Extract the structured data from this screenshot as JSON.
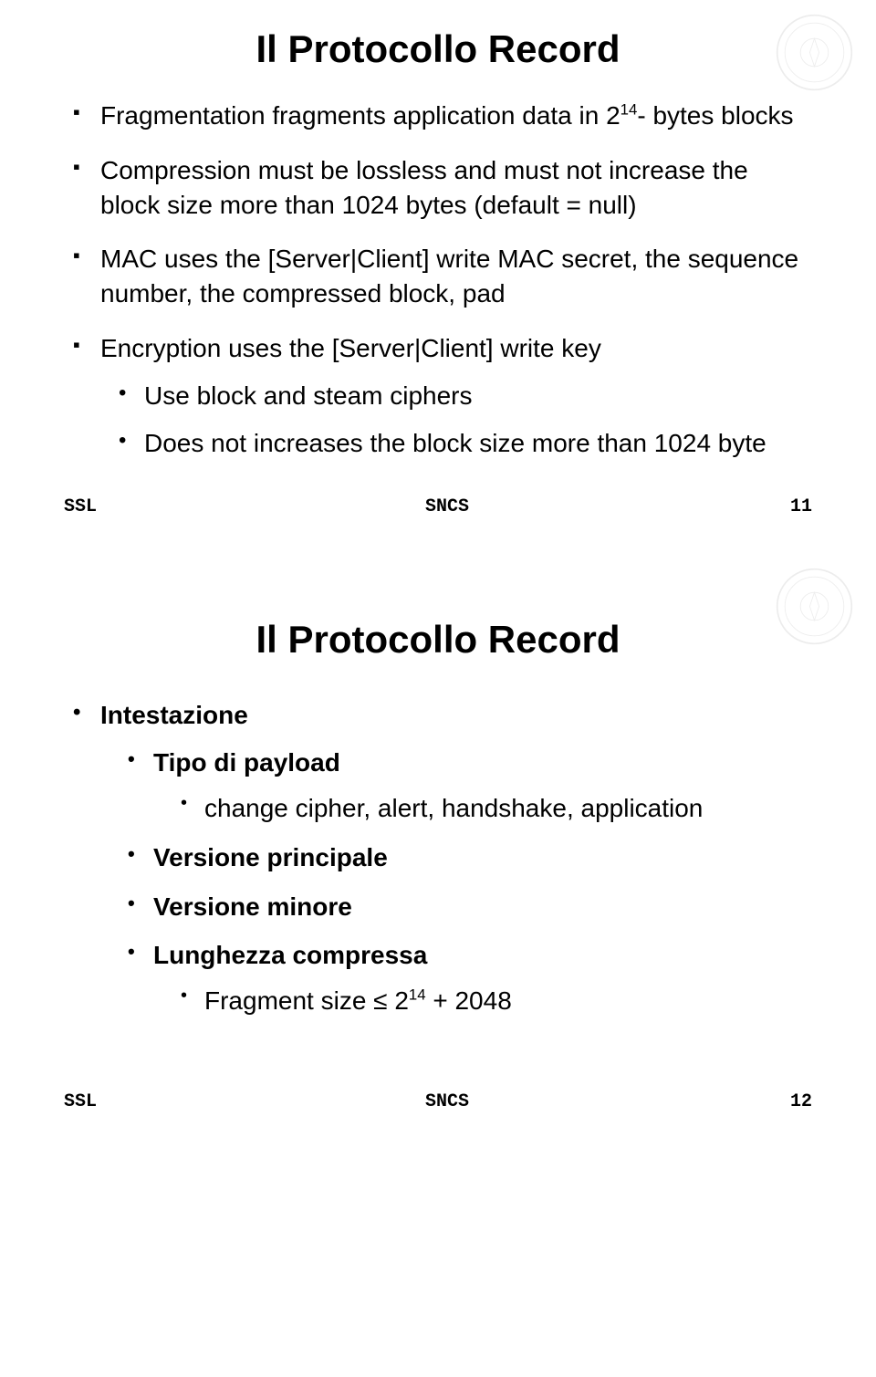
{
  "slide1": {
    "title": "Il Protocollo Record",
    "bullets": [
      {
        "text_a": "Fragmentation fragments application data in 2",
        "sup": "14",
        "text_b": "- bytes blocks"
      },
      {
        "text": "Compression must be lossless and must not increase the block size more than 1024 bytes (default = null)"
      },
      {
        "text": "MAC uses the [Server|Client] write MAC secret, the sequence number, the compressed block, pad"
      },
      {
        "text": "Encryption uses the [Server|Client] write key",
        "sub": [
          {
            "text": "Use block and steam ciphers"
          },
          {
            "text": "Does not increases the block size more than 1024 byte"
          }
        ]
      }
    ],
    "footer": {
      "left": "SSL",
      "center": "SNCS",
      "right": "11"
    }
  },
  "slide2": {
    "title": "Il Protocollo Record",
    "item": {
      "label": "Intestazione",
      "children": [
        {
          "label": "Tipo di payload",
          "sub": [
            {
              "text": "change cipher, alert, handshake, application"
            }
          ]
        },
        {
          "label": "Versione principale"
        },
        {
          "label": "Versione minore"
        },
        {
          "label": "Lunghezza compressa",
          "sub": [
            {
              "text_a": "Fragment size ≤ 2",
              "sup": "14",
              "text_b": " + 2048"
            }
          ]
        }
      ]
    },
    "footer": {
      "left": "SSL",
      "center": "SNCS",
      "right": "12"
    }
  }
}
